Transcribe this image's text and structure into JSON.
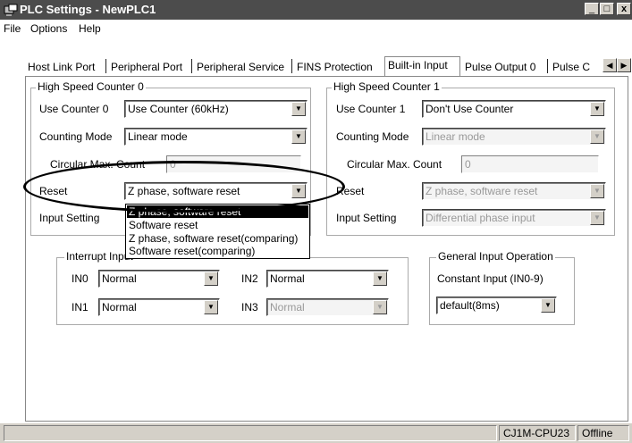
{
  "window": {
    "title": "PLC Settings - NewPLC1",
    "minimize": "_",
    "maximize": "□",
    "close": "x"
  },
  "menu": [
    "File",
    "Options",
    "Help"
  ],
  "tabs": [
    {
      "label": "Host Link Port"
    },
    {
      "label": "Peripheral Port"
    },
    {
      "label": "Peripheral Service"
    },
    {
      "label": "FINS Protection"
    },
    {
      "label": "Built-in Input"
    },
    {
      "label": "Pulse Output 0"
    },
    {
      "label": "Pulse C"
    }
  ],
  "hsc0": {
    "title": "High Speed Counter 0",
    "use_label": "Use Counter 0",
    "use_value": "Use Counter (60kHz)",
    "mode_label": "Counting Mode",
    "mode_value": "Linear mode",
    "circ_label": "Circular Max. Count",
    "circ_value": "0",
    "reset_label": "Reset",
    "reset_value": "Z phase, software reset",
    "input_label": "Input Setting"
  },
  "reset_options": [
    "Z phase, software reset",
    "Software reset",
    "Z phase, software reset(comparing)",
    "Software reset(comparing)"
  ],
  "hsc1": {
    "title": "High Speed Counter 1",
    "use_label": "Use Counter 1",
    "use_value": "Don't Use Counter",
    "mode_label": "Counting Mode",
    "mode_value": "Linear mode",
    "circ_label": "Circular Max. Count",
    "circ_value": "0",
    "reset_label": "Reset",
    "reset_value": "Z phase, software reset",
    "input_label": "Input Setting",
    "input_value": "Differential phase input"
  },
  "interrupt": {
    "title": "Interrupt Input",
    "in0_label": "IN0",
    "in0_value": "Normal",
    "in1_label": "IN1",
    "in1_value": "Normal",
    "in2_label": "IN2",
    "in2_value": "Normal",
    "in3_label": "IN3",
    "in3_value": "Normal"
  },
  "general": {
    "title": "General Input Operation",
    "const_label": "Constant Input (IN0-9)",
    "const_value": "default(8ms)"
  },
  "status": {
    "cpu": "CJ1M-CPU23",
    "mode": "Offline"
  },
  "icons": {
    "dropdown": "triangle-down",
    "scroll_left": "triangle-left",
    "scroll_right": "triangle-right"
  }
}
